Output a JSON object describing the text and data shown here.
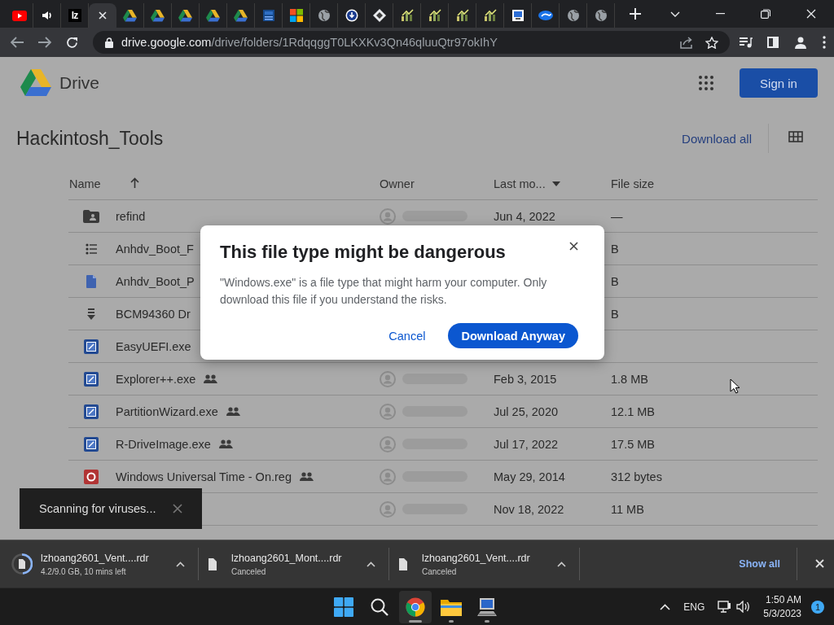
{
  "browser": {
    "tabs": [
      {
        "kind": "play",
        "selected": false
      },
      {
        "kind": "speaker",
        "selected": false
      },
      {
        "kind": "logo",
        "text": "lz",
        "selected": false
      },
      {
        "kind": "active",
        "selected": true
      },
      {
        "kind": "drive",
        "selected": false
      },
      {
        "kind": "drive",
        "selected": false
      },
      {
        "kind": "drive",
        "selected": false
      },
      {
        "kind": "drive",
        "selected": false
      },
      {
        "kind": "drive",
        "selected": false
      },
      {
        "kind": "newspaper",
        "selected": false
      },
      {
        "kind": "windows",
        "selected": false
      },
      {
        "kind": "globe",
        "selected": false
      },
      {
        "kind": "download",
        "selected": false
      },
      {
        "kind": "diamond",
        "selected": false
      },
      {
        "kind": "chart",
        "selected": false
      },
      {
        "kind": "chart",
        "selected": false
      },
      {
        "kind": "chart",
        "selected": false
      },
      {
        "kind": "chart",
        "selected": false
      },
      {
        "kind": "monitor",
        "selected": false
      },
      {
        "kind": "cloud",
        "selected": false
      },
      {
        "kind": "globe",
        "selected": false
      },
      {
        "kind": "globe",
        "selected": false
      }
    ],
    "url": {
      "host": "drive.google.com",
      "path": "/drive/folders/1RdqqggT0LKXKv3Qn46qluuQtr97okIhY"
    }
  },
  "drive": {
    "app_name": "Drive",
    "sign_in": "Sign in",
    "folder_title": "Hackintosh_Tools",
    "download_all": "Download all",
    "columns": [
      "Name",
      "Owner",
      "Last mo...",
      "File size"
    ],
    "rows": [
      {
        "kind": "folder",
        "name": "refind",
        "owner_avatar": true,
        "modified": "Jun 4, 2022",
        "size": "—"
      },
      {
        "kind": "list",
        "name": "Anhdv_Boot_F",
        "owner_avatar": false,
        "size": "B"
      },
      {
        "kind": "doc",
        "name": "Anhdv_Boot_P",
        "owner_avatar": false,
        "size": "B"
      },
      {
        "kind": "archive",
        "name": "BCM94360 Dr",
        "owner_avatar": false,
        "size": "B"
      },
      {
        "kind": "exe",
        "name": "EasyUEFI.exe",
        "owner_avatar": false
      },
      {
        "kind": "exe",
        "name": "Explorer++.exe",
        "shared": true,
        "owner_avatar": true,
        "modified": "Feb 3, 2015",
        "size": "1.8 MB"
      },
      {
        "kind": "exe",
        "name": "PartitionWizard.exe",
        "shared": true,
        "owner_avatar": true,
        "modified": "Jul 25, 2020",
        "size": "12.1 MB"
      },
      {
        "kind": "exe",
        "name": "R-DriveImage.exe",
        "shared": true,
        "owner_avatar": true,
        "modified": "Jul 17, 2022",
        "size": "17.5 MB"
      },
      {
        "kind": "reg",
        "name": "Windows Universal Time - On.reg",
        "shared": true,
        "owner_avatar": true,
        "modified": "May 29, 2014",
        "size": "312 bytes"
      },
      {
        "owner_avatar": true,
        "modified": "Nov 18, 2022",
        "size": "11 MB"
      }
    ],
    "dialog": {
      "title": "This file type might be dangerous",
      "body": "\"Windows.exe\" is a file type that might harm your computer. Only download this file if you understand the risks.",
      "cancel": "Cancel",
      "confirm": "Download Anyway"
    },
    "toast": {
      "text": "Scanning for viruses..."
    }
  },
  "downloads": {
    "items": [
      {
        "name": "lzhoang2601_Vent....rdr",
        "status": "4.2/9.0 GB, 10 mins left",
        "in_progress": true
      },
      {
        "name": "lzhoang2601_Mont....rdr",
        "status": "Canceled",
        "in_progress": false
      },
      {
        "name": "lzhoang2601_Vent....rdr",
        "status": "Canceled",
        "in_progress": false
      }
    ],
    "show_all": "Show all"
  },
  "taskbar": {
    "apps": [
      {
        "kind": "start",
        "running": false
      },
      {
        "kind": "search",
        "running": false
      },
      {
        "kind": "browser",
        "running": true
      },
      {
        "kind": "folder",
        "running": true
      },
      {
        "kind": "computer",
        "running": true
      }
    ],
    "language": "ENG",
    "time": "1:50 AM",
    "date": "5/3/2023",
    "notifications": "1"
  }
}
